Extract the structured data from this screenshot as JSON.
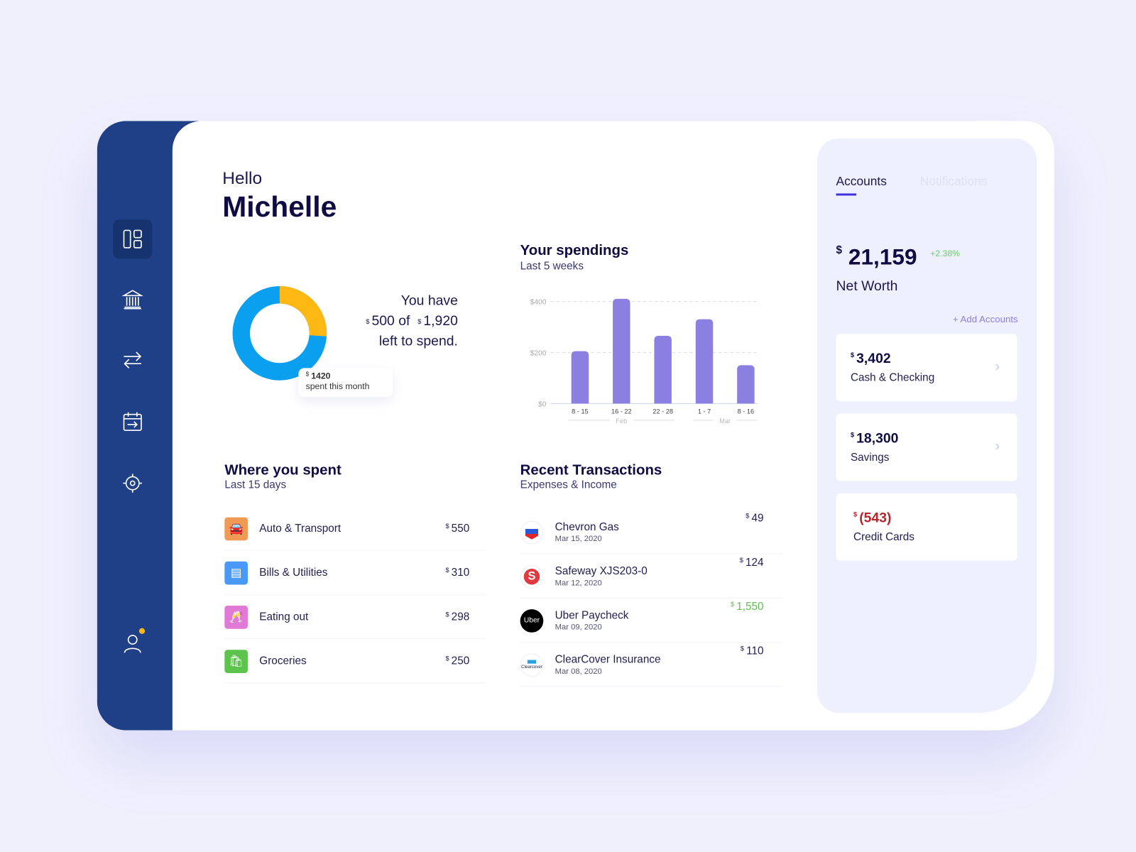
{
  "sidebar": {
    "items": [
      {
        "icon": "dashboard-icon",
        "active": true
      },
      {
        "icon": "bank-icon"
      },
      {
        "icon": "transfer-icon"
      },
      {
        "icon": "calendar-icon"
      },
      {
        "icon": "settings-icon"
      }
    ],
    "profile_icon": "user-icon",
    "notification_dot_color": "#fdb813"
  },
  "greeting": {
    "hello": "Hello",
    "name": "Michelle"
  },
  "budget": {
    "line1": "You have",
    "left_currency": "$",
    "left_amount": "500",
    "of": "of",
    "total_currency": "$",
    "total_amount": "1,920",
    "line3": "left to spend.",
    "spent_currency": "$",
    "spent_amount": "1420",
    "spent_label": "spent this month",
    "spent_value": 1420,
    "total_value": 1920,
    "colors": {
      "spent": "#0aa0ef",
      "left": "#fdb813"
    }
  },
  "spendings": {
    "title": "Your spendings",
    "subtitle": "Last 5 weeks"
  },
  "chart_data": {
    "type": "bar",
    "categories": [
      "8 - 15",
      "16 - 22",
      "22 - 28",
      "1 - 7",
      "8 - 16"
    ],
    "groups": [
      {
        "label": "Feb",
        "span": [
          0,
          2
        ]
      },
      {
        "label": "Mar",
        "span": [
          3,
          4
        ]
      }
    ],
    "values": [
      205,
      410,
      265,
      330,
      150
    ],
    "yticks": [
      "$0",
      "$200",
      "$400"
    ],
    "ylim": [
      0,
      400
    ],
    "grid": true,
    "color": "#8b80e1"
  },
  "where": {
    "title": "Where you spent",
    "subtitle": "Last 15 days",
    "items": [
      {
        "label": "Auto & Transport",
        "currency": "$",
        "amount": "550",
        "icon": "car-icon",
        "color": "#ef9a55"
      },
      {
        "label": "Bills & Utilities",
        "currency": "$",
        "amount": "310",
        "icon": "receipt-icon",
        "color": "#4a98f7"
      },
      {
        "label": "Eating out",
        "currency": "$",
        "amount": "298",
        "icon": "glasses-icon",
        "color": "#e07ad6"
      },
      {
        "label": "Groceries",
        "currency": "$",
        "amount": "250",
        "icon": "grocery-bag-icon",
        "color": "#5cc34d"
      }
    ]
  },
  "transactions": {
    "title": "Recent Transactions",
    "subtitle": "Expenses & Income",
    "items": [
      {
        "name": "Chevron Gas",
        "date": "Mar 15, 2020",
        "currency": "$",
        "amount": "49",
        "logo": "Chevron",
        "income": false
      },
      {
        "name": "Safeway XJS203-0",
        "date": "Mar 12, 2020",
        "currency": "$",
        "amount": "124",
        "logo": "S",
        "income": false
      },
      {
        "name": "Uber Paycheck",
        "date": "Mar 09, 2020",
        "currency": "$",
        "amount": "1,550",
        "logo": "Uber",
        "income": true
      },
      {
        "name": "ClearCover Insurance",
        "date": "Mar 08, 2020",
        "currency": "$",
        "amount": "110",
        "logo": "Clearcover",
        "income": false
      }
    ]
  },
  "right_panel": {
    "tabs": [
      "Accounts",
      "Notifications"
    ],
    "net_worth": {
      "currency": "$",
      "amount": "21,159",
      "change": "+2.38%",
      "label": "Net Worth"
    },
    "add_accounts": "+ Add Accounts",
    "accounts": [
      {
        "currency": "$",
        "amount": "3,402",
        "label": "Cash & Checking",
        "negative": false
      },
      {
        "currency": "$",
        "amount": "18,300",
        "label": "Savings",
        "negative": false
      },
      {
        "currency": "$",
        "amount": "(543)",
        "label": "Credit Cards",
        "negative": true
      }
    ]
  }
}
